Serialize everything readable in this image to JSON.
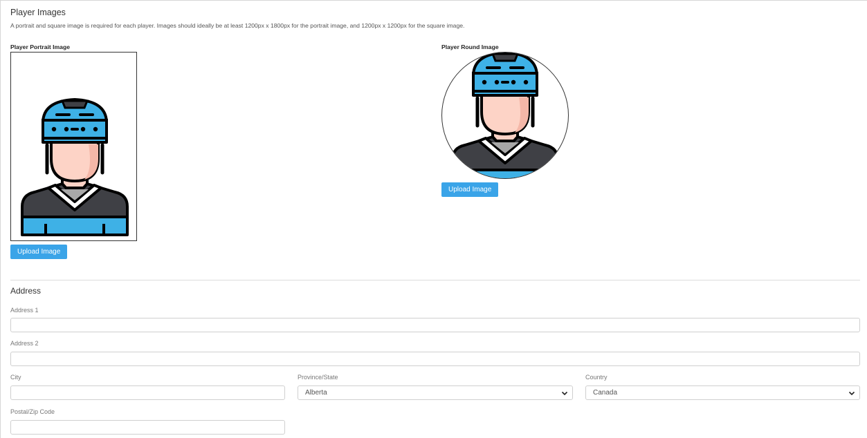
{
  "images_section": {
    "title": "Player Images",
    "description": "A portrait and square image is required for each player. Images should ideally be at least 1200px x 1800px for the portrait image, and 1200px x 1200px for the square image.",
    "portrait": {
      "label": "Player Portrait Image",
      "image": "hockey-player-avatar-icon",
      "button_label": "Upload Image"
    },
    "round": {
      "label": "Player Round Image",
      "image": "hockey-player-avatar-icon",
      "button_label": "Upload Image"
    }
  },
  "address_section": {
    "title": "Address",
    "address1": {
      "label": "Address 1",
      "value": ""
    },
    "address2": {
      "label": "Address 2",
      "value": ""
    },
    "city": {
      "label": "City",
      "value": ""
    },
    "province": {
      "label": "Province/State",
      "selected": "Alberta"
    },
    "country": {
      "label": "Country",
      "selected": "Canada"
    },
    "postal": {
      "label": "Postal/Zip Code",
      "value": ""
    }
  },
  "colors": {
    "button_bg": "#3aa4e8",
    "helmet_blue": "#3eb1e6",
    "skin": "#fdd3c6",
    "jersey_dark": "#3f4045"
  }
}
